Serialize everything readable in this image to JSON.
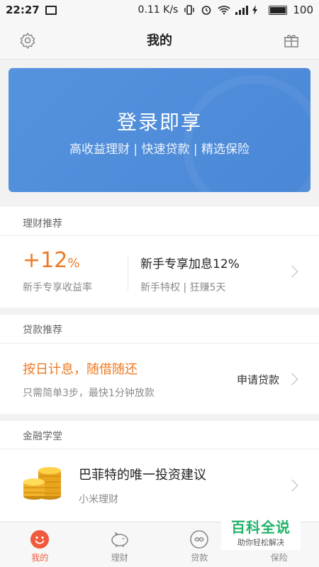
{
  "status_bar": {
    "time": "22:27",
    "speed": "0.11 K/s",
    "battery": "100"
  },
  "header": {
    "title": "我的",
    "left_icon": "settings-gear-icon",
    "right_icon": "gift-icon"
  },
  "login_card": {
    "title": "登录即享",
    "subtitle": "高收益理财 | 快速贷款 | 精选保险",
    "color": "#4f8ddb"
  },
  "finance": {
    "section_title": "理财推荐",
    "rate_value": "+12",
    "rate_unit": "%",
    "rate_label": "新手专享收益率",
    "product_title": "新手专享加息12%",
    "product_desc": "新手特权 | 狂赚5天",
    "accent_color": "#ee7a22"
  },
  "loan": {
    "section_title": "贷款推荐",
    "title": "按日计息，随借随还",
    "desc": "只需简单3步，最快1分钟放款",
    "apply_label": "申请贷款"
  },
  "academy": {
    "section_title": "金融学堂",
    "article_title": "巴菲特的唯一投资建议",
    "article_source": "小米理财",
    "thumbnail_icon": "gold-coins-icon"
  },
  "tabs": [
    {
      "label": "我的",
      "icon": "smiley-icon",
      "active": true
    },
    {
      "label": "理财",
      "icon": "piggy-bank-icon",
      "active": false
    },
    {
      "label": "贷款",
      "icon": "loan-coin-icon",
      "active": false
    },
    {
      "label": "保险",
      "icon": "shield-icon",
      "active": false
    }
  ],
  "watermark": {
    "main": "百科全说",
    "sub": "助你轻松解决"
  }
}
